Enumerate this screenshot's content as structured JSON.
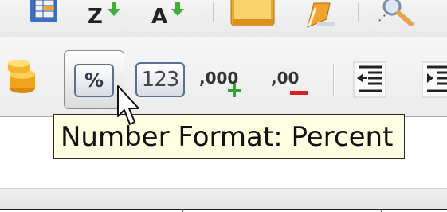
{
  "toolbar_top": {
    "sort_ascending_label": "Z",
    "sort_descending_label": "A",
    "icons": [
      "table-icon",
      "sort-ascending-icon",
      "sort-descending-icon",
      "chart-icon",
      "draw-icon",
      "find-icon"
    ]
  },
  "toolbar_format": {
    "percent_label": "%",
    "standard_label": "123",
    "add_decimal_label": ",000",
    "delete_decimal_label": ",00",
    "icons": [
      "currency-icon",
      "percent-icon",
      "standard-format-icon",
      "add-decimal-icon",
      "delete-decimal-icon",
      "decrease-indent-icon",
      "increase-indent-icon"
    ]
  },
  "tooltip": {
    "text": "Number Format: Percent"
  },
  "colors": {
    "tooltip_bg": "#ffffe1",
    "add_green": "#2ea52e",
    "delete_red": "#d42020",
    "sort_arrow_green": "#3cae3c"
  }
}
